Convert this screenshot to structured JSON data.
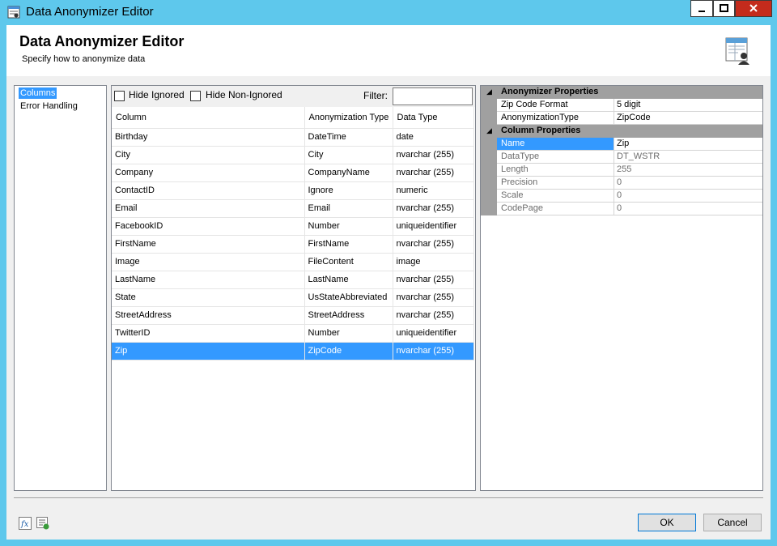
{
  "window": {
    "title": "Data Anonymizer Editor"
  },
  "header": {
    "title": "Data Anonymizer Editor",
    "subtitle": "Specify how to anonymize data"
  },
  "nav": {
    "items": [
      {
        "label": "Columns",
        "selected": true
      },
      {
        "label": "Error Handling",
        "selected": false
      }
    ]
  },
  "filters": {
    "hide_ignored": "Hide Ignored",
    "hide_non_ignored": "Hide Non-Ignored",
    "filter_label": "Filter:",
    "filter_value": ""
  },
  "columns_table": {
    "headers": [
      "Column",
      "Anonymization Type",
      "Data Type"
    ],
    "rows": [
      [
        "Birthday",
        "DateTime",
        "date"
      ],
      [
        "City",
        "City",
        "nvarchar (255)"
      ],
      [
        "Company",
        "CompanyName",
        "nvarchar (255)"
      ],
      [
        "ContactID",
        "Ignore",
        "numeric"
      ],
      [
        "Email",
        "Email",
        "nvarchar (255)"
      ],
      [
        "FacebookID",
        "Number",
        "uniqueidentifier"
      ],
      [
        "FirstName",
        "FirstName",
        "nvarchar (255)"
      ],
      [
        "Image",
        "FileContent",
        "image"
      ],
      [
        "LastName",
        "LastName",
        "nvarchar (255)"
      ],
      [
        "State",
        "UsStateAbbreviated",
        "nvarchar (255)"
      ],
      [
        "StreetAddress",
        "StreetAddress",
        "nvarchar (255)"
      ],
      [
        "TwitterID",
        "Number",
        "uniqueidentifier"
      ],
      [
        "Zip",
        "ZipCode",
        "nvarchar (255)"
      ]
    ],
    "selected_row": "Zip"
  },
  "properties": {
    "anonymizer_category": "Anonymizer Properties",
    "anonymizer": [
      {
        "name": "Zip Code Format",
        "value": "5 digit"
      },
      {
        "name": "AnonymizationType",
        "value": "ZipCode"
      }
    ],
    "column_category": "Column Properties",
    "column": [
      {
        "name": "Name",
        "value": "Zip"
      },
      {
        "name": "DataType",
        "value": "DT_WSTR"
      },
      {
        "name": "Length",
        "value": "255"
      },
      {
        "name": "Precision",
        "value": "0"
      },
      {
        "name": "Scale",
        "value": "0"
      },
      {
        "name": "CodePage",
        "value": "0"
      }
    ]
  },
  "buttons": {
    "ok": "OK",
    "cancel": "Cancel"
  },
  "colors": {
    "titlebar": "#5ec8ec",
    "selection": "#3399ff",
    "close_button": "#c42b1c",
    "category_bg": "#a0a0a0"
  }
}
